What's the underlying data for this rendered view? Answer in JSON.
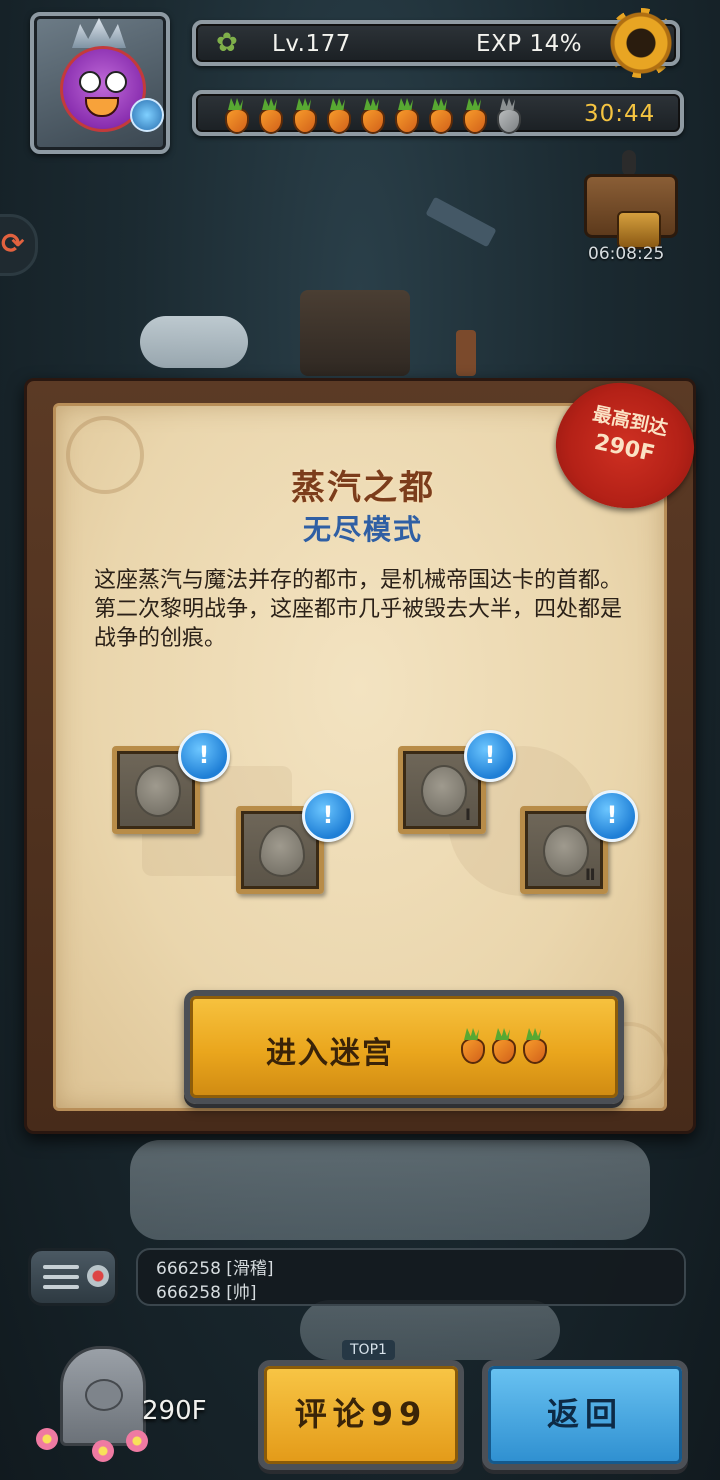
{
  "hud": {
    "level": "Lv.177",
    "exp": "EXP 14%",
    "carrots": {
      "full": 8,
      "empty": 1
    },
    "timer": "30:44",
    "chest_timer": "06:08:25"
  },
  "panel": {
    "title": "蒸汽之都",
    "subtitle": "无尽模式",
    "seal_line1": "最高到达",
    "seal_line2": "290F",
    "description": "这座蒸汽与魔法并存的都市，是机械帝国达卡的首都。第二次黎明战争，这座都市几乎被毁去大半，四处都是战争的创痕。",
    "badge_symbol": "!",
    "slot_marks": [
      "",
      "",
      "Ⅰ",
      "Ⅱ"
    ],
    "enter_label": "进入迷宫",
    "enter_cost_carrots": 3
  },
  "map": {
    "top_tag": "TOP1"
  },
  "chat": {
    "messages": [
      {
        "text": "666258 [滑稽]"
      },
      {
        "text": "666258 [帅]"
      }
    ]
  },
  "footer": {
    "floor": "290F",
    "review_label": "评论99",
    "back_label": "返回"
  },
  "colors": {
    "accent_gold": "#eaa61d",
    "accent_blue": "#2e8fd0",
    "seal_red": "#b42117",
    "title_brown": "#7c3d1c",
    "subtitle_blue": "#2f5fa4"
  }
}
